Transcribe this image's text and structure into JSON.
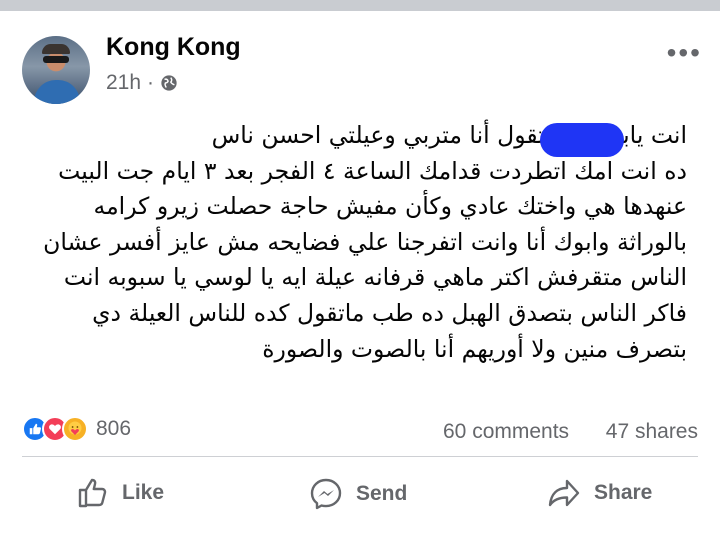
{
  "post": {
    "author": "Kong Kong",
    "time": "21h",
    "separator": "·",
    "more_label": "•••",
    "text_lines": [
      "انت يابن          طالع تقول أنا متربي وعيلتي احسن ناس",
      "ده انت امك اتطردت قدامك الساعة ٤ الفجر بعد ٣ ايام جت البيت",
      "عنهدها هي واختك عادي وكأن مفيش حاجة حصلت زيرو كرامه",
      "بالوراثة وابوك أنا وانت اتفرجنا علي فضايحه مش عايز أفسر عشان",
      "الناس متقرفش اكتر ماهي قرفانه عيلة ايه يا لوسي يا سبوبه انت",
      "فاكر الناس بتصدق الهبل ده طب ماتقول كده للناس العيلة دي",
      "بتصرف منين ولا أوريهم أنا بالصوت والصورة"
    ]
  },
  "stats": {
    "reaction_icons": [
      "like-reaction-icon",
      "love-reaction-icon",
      "care-reaction-icon"
    ],
    "reaction_count": "806",
    "comments": "60 comments",
    "shares": "47 shares"
  },
  "actions": {
    "like": "Like",
    "send": "Send",
    "share": "Share"
  },
  "colors": {
    "accent": "#1877f2",
    "love": "#f33e58",
    "care": "#f7b125",
    "redaction": "#1f35f5",
    "secondary_text": "#65676b"
  }
}
